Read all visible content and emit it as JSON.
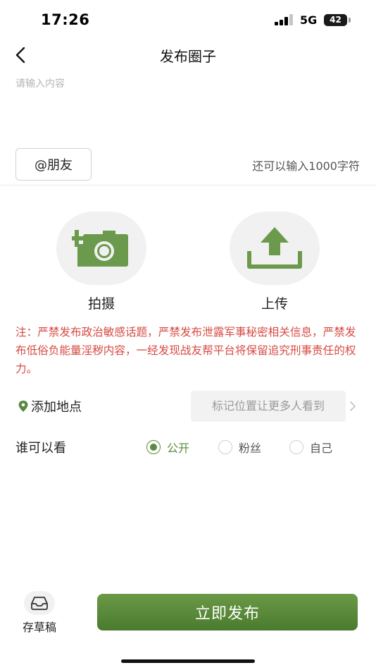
{
  "status": {
    "time": "17:26",
    "network": "5G",
    "battery": "42"
  },
  "nav": {
    "title": "发布圈子"
  },
  "editor": {
    "placeholder": "请输入内容",
    "mention_label": "@朋友",
    "char_count": "还可以输入1000字符"
  },
  "media": {
    "camera_label": "拍摄",
    "upload_label": "上传"
  },
  "notice": "注：严禁发布政治敏感话题，严禁发布泄露军事秘密相关信息，严禁发布低俗负能量淫秽内容，一经发现战友帮平台将保留追究刑事责任的权力。",
  "location": {
    "label": "添加地点",
    "placeholder": "标记位置让更多人看到"
  },
  "visibility": {
    "label": "谁可以看",
    "options": [
      {
        "label": "公开",
        "checked": true
      },
      {
        "label": "粉丝",
        "checked": false
      },
      {
        "label": "自己",
        "checked": false
      }
    ]
  },
  "footer": {
    "draft_label": "存草稿",
    "publish_label": "立即发布"
  },
  "colors": {
    "accent": "#5b8a3e",
    "warning": "#d64a42",
    "icon_bg": "#f1f1f1"
  },
  "icons": [
    "back-icon",
    "camera-add-icon",
    "upload-icon",
    "location-pin-icon",
    "chevron-right-icon",
    "inbox-tray-icon"
  ]
}
